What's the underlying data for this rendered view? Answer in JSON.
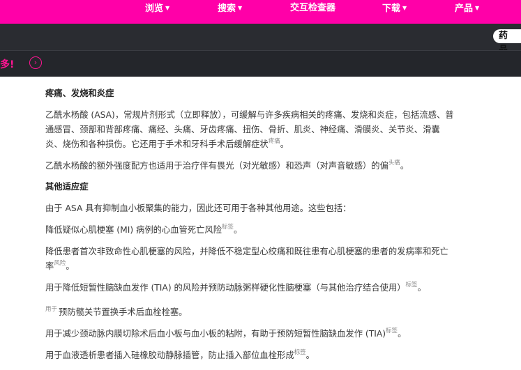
{
  "nav": {
    "items": [
      {
        "label": "浏览",
        "caret": "▼"
      },
      {
        "label": "搜索",
        "caret": "▼"
      },
      {
        "label": "交互检查器",
        "caret": ""
      },
      {
        "label": "下载",
        "caret": "▼"
      },
      {
        "label": "产品",
        "caret": "▼"
      }
    ]
  },
  "search_tab": {
    "label": "药品"
  },
  "promo": {
    "text": "多!",
    "arrow": "›"
  },
  "article": {
    "h1": "疼痛、发烧和炎症",
    "p1": "乙酰水杨酸 (ASA)，常规片剂形式（立即释放），可缓解与许多疾病相关的疼痛、发烧和炎症，包括流感、普通感冒、颈部和背部疼痛、痛经、头痛、牙齿疼痛、扭伤、骨折、肌炎、神经痛、滑膜炎、关节炎、滑囊炎、烧伤和各种损伤。它还用于手术和牙科手术后缓解症状",
    "p1_tag": "疼痛",
    "p2": "乙酰水杨酸的额外强度配方也适用于治疗伴有畏光（对光敏感）和恐声（对声音敏感）的偏",
    "p2_tag": "头痛",
    "h2": "其他适应症",
    "p3": "由于 ASA 具有抑制血小板聚集的能力，因此还可用于各种其他用途。这些包括：",
    "p4": "降低疑似心肌梗塞 (MI) 病例的心血管死亡风险",
    "p4_tag": "标签",
    "p4_end": "。",
    "p5": "降低患者首次非致命性心肌梗塞的风险，并降低不稳定型心绞痛和既往患有心肌梗塞的患者的发病率和死亡率",
    "p5_tag": "风险",
    "p5_end": "。",
    "p6": "用于降低短暂性脑缺血发作 (TIA) 的风险并预防动脉粥样硬化性脑梗塞（与其他治疗结合使用）",
    "p6_tag": "标签",
    "p6_end": "。",
    "p7_tag": "用于",
    "p7": "预防髋关节置换手术后血栓栓塞。",
    "p8": "用于减少颈动脉内膜切除术后血小板与血小板的粘附，有助于预防短暂性脑缺血发作 (TIA)",
    "p8_tag": "标签",
    "p8_end": "。",
    "p9": "用于血液透析患者插入硅橡胶动静脉插管，防止插入部位血栓形成",
    "p9_tag": "标签",
    "p9_end": "。"
  }
}
